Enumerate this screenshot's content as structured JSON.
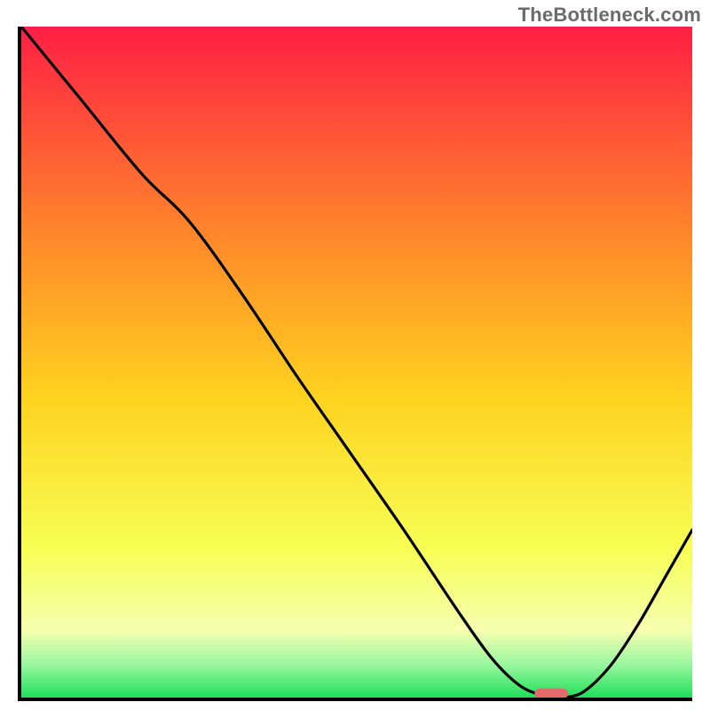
{
  "watermark": "TheBottleneck.com",
  "colors": {
    "gradient_top": "#ff1f44",
    "gradient_upper_mid": "#ff8a2a",
    "gradient_mid": "#ffd21f",
    "gradient_lower_mid": "#f7ff55",
    "gradient_low": "#f5ffb0",
    "gradient_green_light": "#9cf7a0",
    "gradient_green": "#1ee05a",
    "curve_stroke": "#000000",
    "marker_fill": "#e26a6a",
    "axis": "#000000"
  },
  "chart_data": {
    "type": "line",
    "title": "",
    "xlabel": "",
    "ylabel": "",
    "xlim": [
      0,
      100
    ],
    "ylim": [
      0,
      100
    ],
    "x": [
      0,
      9,
      18,
      25,
      33,
      41,
      49,
      57,
      65,
      70,
      74,
      77,
      79,
      81,
      84,
      88,
      92,
      96,
      100
    ],
    "y": [
      100,
      89,
      78,
      71,
      60,
      48,
      36.5,
      25,
      13,
      6,
      2,
      0.5,
      0,
      0,
      1,
      5,
      11,
      18,
      25
    ],
    "series": [
      {
        "name": "bottleneck-curve",
        "x_ref": "x",
        "y_ref": "y"
      }
    ],
    "marker": {
      "x": 79,
      "y": 0.6,
      "width": 5,
      "height": 1.5
    },
    "annotations": []
  }
}
